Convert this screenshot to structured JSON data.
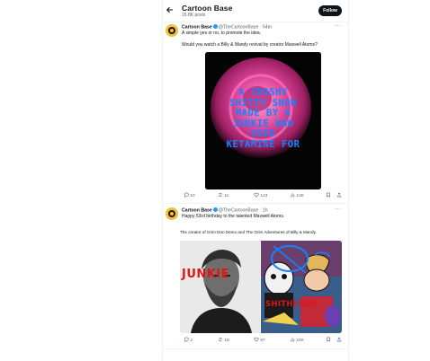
{
  "header": {
    "title": "Cartoon Base",
    "posts_count": "15.8K posts",
    "follow_label": "Follow"
  },
  "tweets": [
    {
      "name": "Cartoon Base",
      "handle": "@TheCartoonBase",
      "time": "54m",
      "more": "···",
      "text_line1": "A simple yes or no, to promote the idea.",
      "text_line2": "Would you watch a Billy & Mandy revival by creator Maxwell Atoms?",
      "image_overlay_text": [
        "A TRASHY",
        "SHITTY SHOW",
        "MADE BY A",
        "JUNKIE WHO",
        "USED",
        "KETAMINE FOR"
      ],
      "actions": {
        "replies": "10",
        "reposts": "11",
        "likes": "123",
        "views": "13K"
      }
    },
    {
      "name": "Cartoon Base",
      "handle": "@TheCartoonBase",
      "time": "1h",
      "more": "···",
      "text_line1": "Happy 53rd birthday to the talented Maxwell Atoms.",
      "text_line2": "The creator of Grim Don Demo and The Grim Adventures of Billy & Mandy.",
      "image_overlay_left": "JUNKIE",
      "image_overlay_right": "SHITHEADS",
      "actions": {
        "replies": "2",
        "reposts": "18",
        "likes": "97",
        "views": "24K"
      }
    }
  ],
  "colors": {
    "accent": "#1d9bf0",
    "text": "#0f1419",
    "muted": "#536471",
    "overlay_blue": "#1583ff",
    "overlay_red": "#e01414",
    "avatar": "#f2c230"
  },
  "icons": [
    "back-arrow-icon",
    "verified-badge-icon",
    "more-icon",
    "reply-icon",
    "repost-icon",
    "like-icon",
    "views-icon",
    "bookmark-icon",
    "share-icon"
  ]
}
